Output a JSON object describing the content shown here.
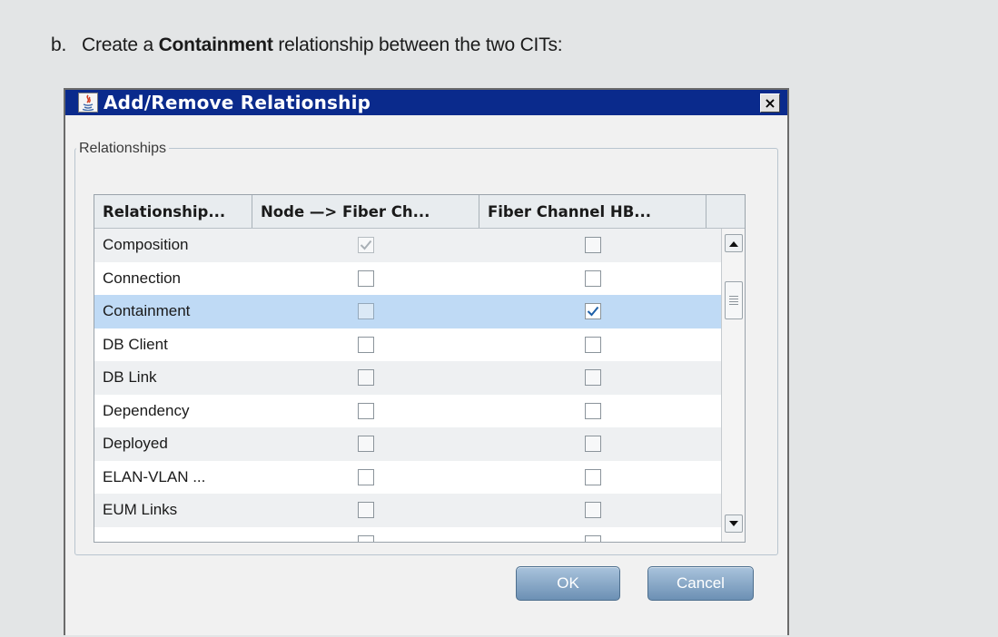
{
  "instruction": {
    "number": "b.",
    "prefix": "Create a",
    "bold": "Containment",
    "suffix": "relationship between the two CITs:"
  },
  "dialog": {
    "title": "Add/Remove Relationship",
    "close_label": "×",
    "group_label": "Relationships",
    "columns": [
      "Relationship...",
      "Node —> Fiber Ch...",
      "Fiber Channel HB..."
    ],
    "rows": [
      {
        "name": "Composition",
        "col1_checked": true,
        "col1_disabled": true,
        "col2_checked": false
      },
      {
        "name": "Connection",
        "col1_checked": false,
        "col1_disabled": false,
        "col2_checked": false
      },
      {
        "name": "Containment",
        "col1_checked": false,
        "col1_disabled": true,
        "col2_checked": true,
        "selected": true
      },
      {
        "name": "DB Client",
        "col1_checked": false,
        "col1_disabled": false,
        "col2_checked": false
      },
      {
        "name": "DB Link",
        "col1_checked": false,
        "col1_disabled": false,
        "col2_checked": false
      },
      {
        "name": "Dependency",
        "col1_checked": false,
        "col1_disabled": false,
        "col2_checked": false
      },
      {
        "name": "Deployed",
        "col1_checked": false,
        "col1_disabled": false,
        "col2_checked": false
      },
      {
        "name": "ELAN-VLAN ...",
        "col1_checked": false,
        "col1_disabled": false,
        "col2_checked": false
      },
      {
        "name": "EUM Links",
        "col1_checked": false,
        "col1_disabled": false,
        "col2_checked": false
      },
      {
        "name": "",
        "col1_checked": false,
        "col1_disabled": false,
        "col2_checked": false
      }
    ],
    "ok_label": "OK",
    "cancel_label": "Cancel"
  },
  "colors": {
    "titlebar": "#0a2a8c",
    "selected_row": "#bfdaf5",
    "check": "#1d5fa8",
    "button": "#7f9fc0"
  }
}
